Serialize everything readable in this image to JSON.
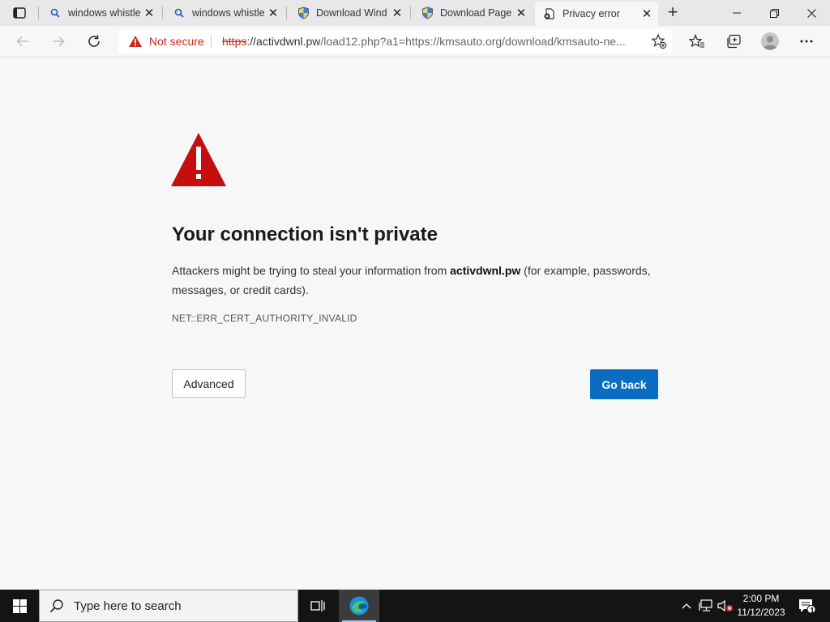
{
  "browser": {
    "tabs": [
      {
        "title": "windows whistle",
        "favicon": "search-icon"
      },
      {
        "title": "windows whistle",
        "favicon": "search-icon"
      },
      {
        "title": "Download Wind",
        "favicon": "shield-icon"
      },
      {
        "title": "Download Page",
        "favicon": "shield-icon"
      },
      {
        "title": "Privacy error",
        "favicon": "error-page-icon",
        "active": true
      }
    ],
    "address": {
      "security_label": "Not secure",
      "url_scheme": "https",
      "url_host": "://activdwnl.pw",
      "url_path": "/load12.php?a1=https://kmsauto.org/download/kmsauto-ne..."
    }
  },
  "page": {
    "heading": "Your connection isn't private",
    "desc_before": "Attackers might be trying to steal your information from ",
    "desc_host": "activdwnl.pw",
    "desc_after": " (for example, passwords, messages, or credit cards).",
    "error_code": "NET::ERR_CERT_AUTHORITY_INVALID",
    "advanced_label": "Advanced",
    "go_back_label": "Go back"
  },
  "taskbar": {
    "search_placeholder": "Type here to search",
    "time": "2:00 PM",
    "date": "11/12/2023",
    "notification_count": "1"
  },
  "colors": {
    "warning_red": "#c42b1c",
    "primary_button": "#0a6dc2",
    "taskbar": "#141414"
  }
}
